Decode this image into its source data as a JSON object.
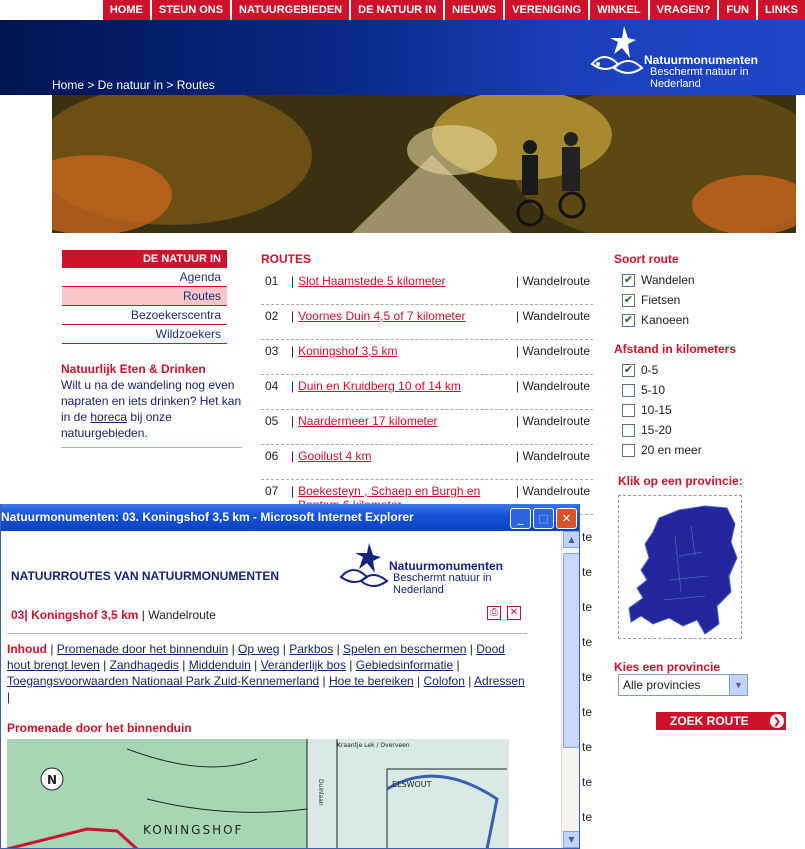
{
  "topnav": [
    "HOME",
    "STEUN ONS",
    "NATUURGEBIEDEN",
    "DE NATUUR IN",
    "NIEUWS",
    "VERENIGING",
    "WINKEL",
    "VRAGEN?",
    "FUN",
    "LINKS"
  ],
  "breadcrumb": "Home > De natuur in > Routes",
  "logo": {
    "name": "Natuurmonumenten",
    "tagline": "Beschermt natuur in Nederland"
  },
  "leftnav": {
    "header": "DE NATUUR IN",
    "items": [
      "Agenda",
      "Routes",
      "Bezoekerscentra",
      "Wildzoekers"
    ]
  },
  "eat": {
    "title": "Natuurlijk Eten & Drinken",
    "text_before": "Wilt u na de wandeling nog even napraten en iets drinken? Het kan in de",
    "link": "horeca",
    "text_after": "bij onze natuurgebieden."
  },
  "routes": {
    "header": "ROUTES",
    "items": [
      {
        "num": "01",
        "name": "Slot Haamstede 5 kilometer",
        "type": "| Wandelroute"
      },
      {
        "num": "02",
        "name": "Voornes Duin 4,5 of 7 kilometer",
        "type": "| Wandelroute"
      },
      {
        "num": "03",
        "name": "Koningshof 3,5 km",
        "type": "| Wandelroute"
      },
      {
        "num": "04",
        "name": "Duin en Kruidberg 10 of 14 km",
        "type": "| Wandelroute"
      },
      {
        "num": "05",
        "name": "Naardermeer 17 kilometer",
        "type": "| Wandelroute"
      },
      {
        "num": "06",
        "name": "Gooilust 4 km",
        "type": "| Wandelroute"
      },
      {
        "num": "07",
        "name": "Boekesteyn , Schaep en Burgh en Bantam 6 kilometer",
        "type": "| Wandelroute"
      }
    ],
    "behind_fragments": [
      "te",
      "te",
      "te",
      "te",
      "te",
      "te",
      "te",
      "te",
      "te"
    ]
  },
  "filters": {
    "soort_title": "Soort route",
    "soort": [
      {
        "label": "Wandelen",
        "checked": true
      },
      {
        "label": "Fietsen",
        "checked": true
      },
      {
        "label": "Kanoeen",
        "checked": true
      }
    ],
    "afstand_title": "Afstand in kilometers",
    "afstand": [
      {
        "label": "0-5",
        "checked": true
      },
      {
        "label": "5-10",
        "checked": false
      },
      {
        "label": "10-15",
        "checked": false
      },
      {
        "label": "15-20",
        "checked": false
      },
      {
        "label": "20 en meer",
        "checked": false
      }
    ],
    "map_title": "Klik op een provincie:",
    "province_title": "Kies een provincie",
    "province_value": "Alle provincies",
    "submit": "ZOEK ROUTE"
  },
  "popup": {
    "window_title": "Natuurmonumenten: 03. Koningshof 3,5 km - Microsoft Internet Explorer",
    "heading": "NATUURROUTES VAN NATUURMONUMENTEN",
    "route_num": "03|",
    "route_name": "Koningshof 3,5 km",
    "route_type": "| Wandelroute",
    "toc_label": "Inhoud",
    "toc_links": [
      "Promenade door het binnenduin",
      "Op weg",
      "Parkbos",
      "Spelen en beschermen",
      "Dood hout brengt leven",
      "Zandhagedis",
      "Middenduin",
      "Veranderlijk bos",
      "Gebiedsinformatie",
      "Toegangsvoorwaarden Nationaal Park Zuid-Kennemerland",
      "Hoe te bereiken",
      "Colofon",
      "Adressen"
    ],
    "section_title": "Promenade door het binnenduin",
    "map_labels": {
      "area": "KONINGSHOF",
      "place": "ELSWOUT",
      "road": "Kraantje Lek / Overveen",
      "lane": "Duinlaan"
    }
  },
  "colors": {
    "accent": "#d0112b",
    "navy": "#14237e",
    "banner": "#0a2a8a"
  }
}
